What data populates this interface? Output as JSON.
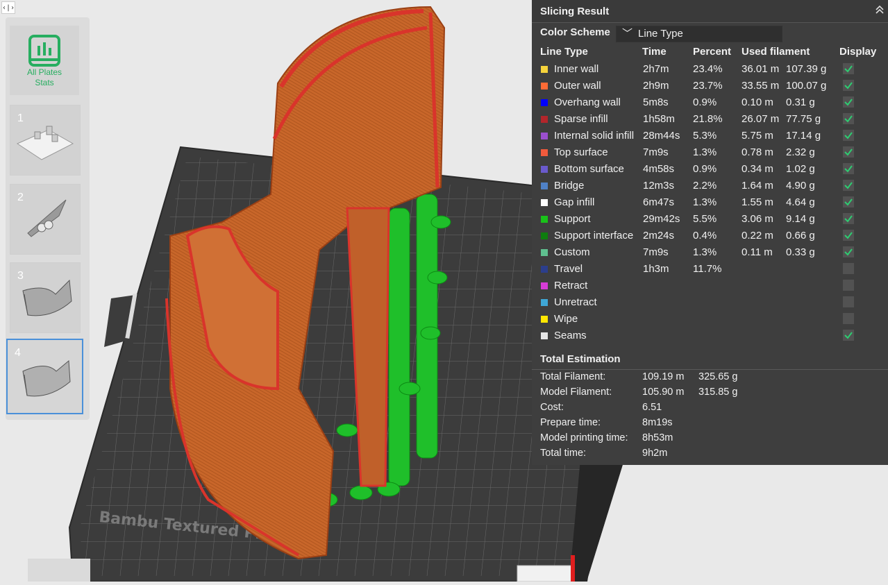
{
  "panel": {
    "title": "Slicing Result",
    "color_scheme_label": "Color Scheme",
    "color_scheme_value": "Line Type",
    "headers": {
      "line_type": "Line Type",
      "time": "Time",
      "percent": "Percent",
      "used": "Used filament",
      "display": "Display"
    },
    "rows": [
      {
        "name": "Inner wall",
        "color": "#f5d33b",
        "time": "2h7m",
        "percent": "23.4%",
        "m": "36.01 m",
        "g": "107.39 g",
        "display": true
      },
      {
        "name": "Outer wall",
        "color": "#ff6b35",
        "time": "2h9m",
        "percent": "23.7%",
        "m": "33.55 m",
        "g": "100.07 g",
        "display": true
      },
      {
        "name": "Overhang wall",
        "color": "#0000ff",
        "time": "5m8s",
        "percent": "0.9%",
        "m": "0.10 m",
        "g": "0.31 g",
        "display": true
      },
      {
        "name": "Sparse infill",
        "color": "#b3262b",
        "time": "1h58m",
        "percent": "21.8%",
        "m": "26.07 m",
        "g": "77.75 g",
        "display": true
      },
      {
        "name": "Internal solid infill",
        "color": "#9b4fcf",
        "time": "28m44s",
        "percent": "5.3%",
        "m": "5.75 m",
        "g": "17.14 g",
        "display": true
      },
      {
        "name": "Top surface",
        "color": "#f05a3c",
        "time": "7m9s",
        "percent": "1.3%",
        "m": "0.78 m",
        "g": "2.32 g",
        "display": true
      },
      {
        "name": "Bottom surface",
        "color": "#6a5acd",
        "time": "4m58s",
        "percent": "0.9%",
        "m": "0.34 m",
        "g": "1.02 g",
        "display": true
      },
      {
        "name": "Bridge",
        "color": "#4f81c7",
        "time": "12m3s",
        "percent": "2.2%",
        "m": "1.64 m",
        "g": "4.90 g",
        "display": true
      },
      {
        "name": "Gap infill",
        "color": "#ffffff",
        "time": "6m47s",
        "percent": "1.3%",
        "m": "1.55 m",
        "g": "4.64 g",
        "display": true
      },
      {
        "name": "Support",
        "color": "#19c219",
        "time": "29m42s",
        "percent": "5.5%",
        "m": "3.06 m",
        "g": "9.14 g",
        "display": true
      },
      {
        "name": "Support interface",
        "color": "#0e7d0e",
        "time": "2m24s",
        "percent": "0.4%",
        "m": "0.22 m",
        "g": "0.66 g",
        "display": true
      },
      {
        "name": "Custom",
        "color": "#5fbf8f",
        "time": "7m9s",
        "percent": "1.3%",
        "m": "0.11 m",
        "g": "0.33 g",
        "display": true
      },
      {
        "name": "Travel",
        "color": "#2c3e8c",
        "time": "1h3m",
        "percent": "11.7%",
        "m": "",
        "g": "",
        "display": false
      },
      {
        "name": "Retract",
        "color": "#d63cd6",
        "time": "",
        "percent": "",
        "m": "",
        "g": "",
        "display": false
      },
      {
        "name": "Unretract",
        "color": "#3fa7d6",
        "time": "",
        "percent": "",
        "m": "",
        "g": "",
        "display": false
      },
      {
        "name": "Wipe",
        "color": "#ffe600",
        "time": "",
        "percent": "",
        "m": "",
        "g": "",
        "display": false
      },
      {
        "name": "Seams",
        "color": "#e6e6e6",
        "time": "",
        "percent": "",
        "m": "",
        "g": "",
        "display": true
      }
    ],
    "total_title": "Total Estimation",
    "totals": [
      {
        "label": "Total Filament:",
        "v1": "109.19 m",
        "v2": "325.65 g"
      },
      {
        "label": "Model Filament:",
        "v1": "105.90 m",
        "v2": "315.85 g"
      },
      {
        "label": "Cost:",
        "v1": "6.51",
        "v2": ""
      },
      {
        "label": "Prepare time:",
        "v1": "8m19s",
        "v2": ""
      },
      {
        "label": "Model printing time:",
        "v1": "8h53m",
        "v2": ""
      },
      {
        "label": "Total time:",
        "v1": "9h2m",
        "v2": ""
      }
    ]
  },
  "plates": {
    "stats_label_line1": "All Plates",
    "stats_label_line2": "Stats",
    "numbers": [
      "1",
      "2",
      "3",
      "4"
    ]
  },
  "bed_label": "Bambu Textured PEI Plate",
  "toggle_label": "‹|›",
  "colors": {
    "wall": "#c8662a",
    "wall_dark": "#a84f1f",
    "support": "#1fbf2a",
    "bed": "#3c3c3c",
    "accent": "#27ae60"
  }
}
